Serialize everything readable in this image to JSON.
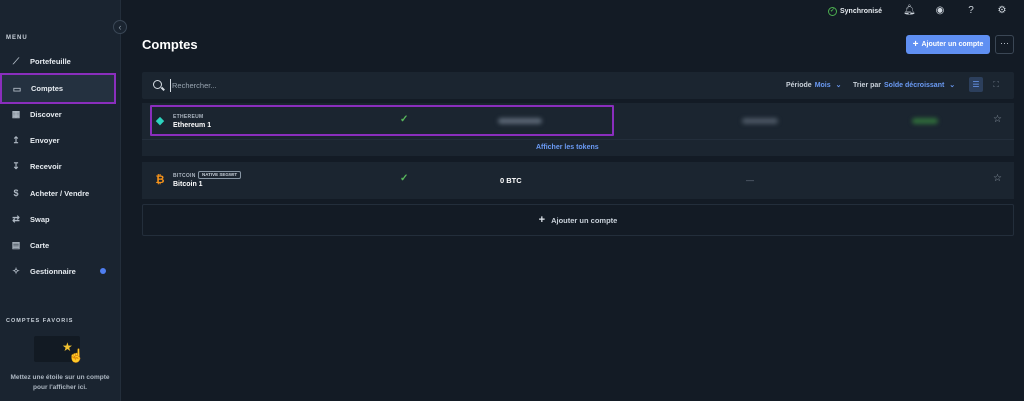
{
  "sidebar": {
    "menu_label": "MENU",
    "items": [
      {
        "label": "Portefeuille",
        "icon": "chart-line-icon"
      },
      {
        "label": "Comptes",
        "icon": "wallet-icon"
      },
      {
        "label": "Discover",
        "icon": "grid-icon"
      },
      {
        "label": "Envoyer",
        "icon": "arrow-up-icon"
      },
      {
        "label": "Recevoir",
        "icon": "arrow-down-icon"
      },
      {
        "label": "Acheter / Vendre",
        "icon": "dollar-icon"
      },
      {
        "label": "Swap",
        "icon": "swap-icon"
      },
      {
        "label": "Carte",
        "icon": "card-icon"
      },
      {
        "label": "Gestionnaire",
        "icon": "tools-icon"
      }
    ],
    "favorites_label": "COMPTES FAVORIS",
    "favorites_hint": "Mettez une étoile sur un compte pour l'afficher ici."
  },
  "topbar": {
    "sync_status": "Synchronisé"
  },
  "page": {
    "title": "Comptes",
    "add_account_button": "Ajouter un compte",
    "more_button": "···"
  },
  "filters": {
    "search_placeholder": "Rechercher...",
    "period_label": "Période",
    "period_value": "Mois",
    "sort_label": "Trier par",
    "sort_value": "Solde décroissant"
  },
  "accounts": [
    {
      "ticker": "ETHEREUM",
      "name": "Ethereum 1",
      "balance": "",
      "badge": ""
    },
    {
      "ticker": "BITCOIN",
      "name": "Bitcoin 1",
      "balance": "0 BTC",
      "badge": "NATIVE SEGWIT",
      "countervalue": "—"
    }
  ],
  "show_tokens_link": "Afficher les tokens",
  "add_account_row": "Ajouter un compte",
  "colors": {
    "accent": "#5f8ff2",
    "highlight": "#8a2ebd",
    "ethereum": "#2dd4bf",
    "bitcoin": "#f7931a",
    "success": "#58b85c"
  }
}
